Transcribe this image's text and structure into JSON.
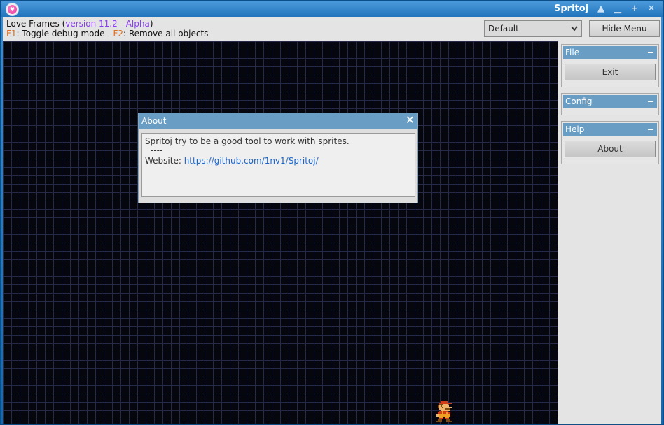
{
  "window": {
    "title": "Spritoj",
    "controls": {
      "up": "▲",
      "minimize": "▁",
      "maximize": "+",
      "close": "✕"
    }
  },
  "info": {
    "app_name": "Love Frames (",
    "version": "version 11.2 - Alpha",
    "app_name_end": ")",
    "f1_key": "F1",
    "f1_desc": ": Toggle debug mode - ",
    "f2_key": "F2",
    "f2_desc": ": Remove all objects"
  },
  "toolbar": {
    "theme_selected": "Default",
    "hide_menu_label": "Hide Menu"
  },
  "about_dialog": {
    "title": "About",
    "line1": "Spritoj try to be a good tool to work with sprites.",
    "line2": "----",
    "website_label": "Website: ",
    "website_url": "https://github.com/1nv1/Spritoj/"
  },
  "sidebar": {
    "file": {
      "title": "File",
      "button": "Exit"
    },
    "config": {
      "title": "Config"
    },
    "help": {
      "title": "Help",
      "button": "About"
    }
  },
  "colors": {
    "panel_header": "#6a9dc4",
    "version_text": "#8a3ff0",
    "hotkey_text": "#e06a1a",
    "link": "#1a64c8",
    "canvas_bg": "#06060f",
    "grid": "#252a48"
  }
}
